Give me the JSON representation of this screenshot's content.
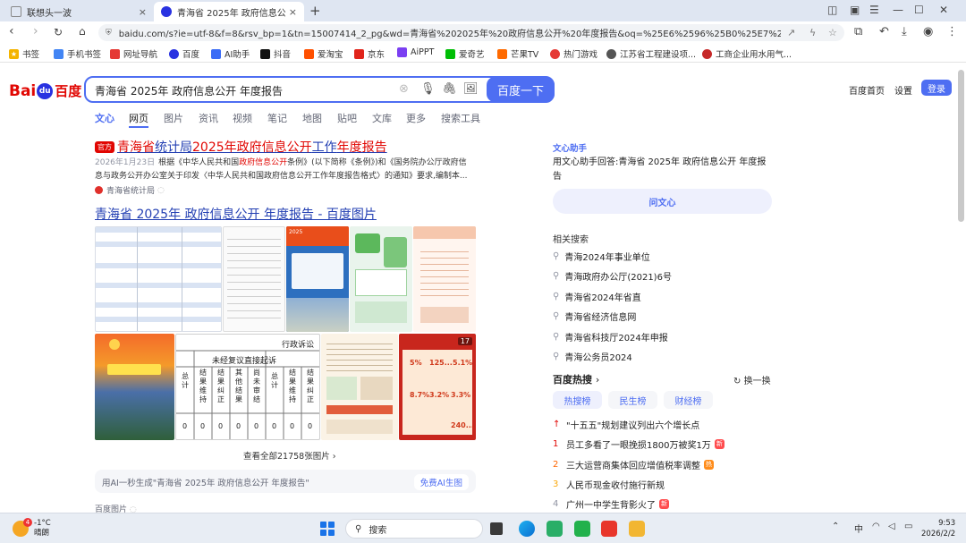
{
  "browser": {
    "tabs": [
      {
        "label": "联想头一波",
        "close": "×"
      },
      {
        "label": "青海省 2025年 政府信息公开 年度",
        "close": "×"
      }
    ],
    "new_tab": "+",
    "url": "baidu.com/s?ie=utf-8&f=8&rsv_bp=1&tn=15007414_2_pg&wd=青海省%202025年%20政府信息公开%20年度报告&oq=%25E6%2596%25B0%25E7%2596%2586%25E7%25BB%25B4%25E5%2590%25BE..."
  },
  "bookmarks": [
    {
      "label": "书签",
      "color": "#f4b400"
    },
    {
      "label": "手机书签",
      "color": "#4285f4"
    },
    {
      "label": "网址导航",
      "color": "#e53935"
    },
    {
      "label": "百度",
      "color": "#2932e1"
    },
    {
      "label": "AI助手",
      "color": "#3b6cf6"
    },
    {
      "label": "抖音",
      "color": "#111111"
    },
    {
      "label": "爱淘宝",
      "color": "#ff5000"
    },
    {
      "label": "京东",
      "color": "#e1251b"
    },
    {
      "label": "AiPPT",
      "color": "#7b3ff2"
    },
    {
      "label": "爱奇艺",
      "color": "#00be06"
    },
    {
      "label": "芒果TV",
      "color": "#ff6a00"
    },
    {
      "label": "热门游戏",
      "color": "#e53935"
    },
    {
      "label": "江苏省工程建设项...",
      "color": "#555555"
    },
    {
      "label": "工商企业用水用气...",
      "color": "#c62828"
    }
  ],
  "baidu": {
    "logo_left": "Bai",
    "logo_paw": "du",
    "logo_right": "百度",
    "query": "青海省 2025年 政府信息公开 年度报告",
    "search_button": "百度一下",
    "header_links": [
      "百度首页",
      "设置"
    ],
    "login": "登录",
    "tabs": [
      "文心",
      "网页",
      "图片",
      "资讯",
      "视频",
      "笔记",
      "地图",
      "贴吧",
      "文库",
      "更多",
      "搜索工具"
    ]
  },
  "result1": {
    "badge": "官方",
    "title_parts": [
      "青海省",
      "统计局",
      "2025年政府信息公开",
      "工作",
      "年度报告"
    ],
    "date": "2026年1月23日",
    "desc_a": "根据《中华人民共和国",
    "desc_hl": "政府信息公开",
    "desc_b": "条例》(以下简称《条例》)和《国务院办公厅政府信息与政务公开办公室关于印发〈中华人民共和国政府信息公开工作年度报告格式〉的通知》要求,编制本...",
    "source": "青海省统计局"
  },
  "result2": {
    "title": "青海省 2025年 政府信息公开 年度报告 - 百度图片"
  },
  "image_grid": {
    "see_all": "查看全部21758张图片",
    "table_header": "行政诉讼",
    "table_sub": "未经复议直接起诉",
    "table_cols": [
      "总计",
      "结果维持",
      "结果纠正",
      "其他结果",
      "尚未审结",
      "总计",
      "结果维持",
      "结果纠正"
    ],
    "table_zero": "0",
    "panel_banner": "2025",
    "photo_badge": "17",
    "stat_values": [
      "5%",
      "125...",
      "5.1%",
      "8.7%",
      "3.2%",
      "3.3%",
      "240..."
    ]
  },
  "ai_bar": {
    "text": "用AI一秒生成\"青海省 2025年 政府信息公开 年度报告\"",
    "button": "免费AI生图"
  },
  "image_source": "百度图片",
  "right": {
    "wenxin_head": "文心助手",
    "wenxin_answer": "用文心助手回答:青海省 2025年 政府信息公开 年度报告",
    "ask_button": "问文心",
    "related_head": "相关搜索",
    "related": [
      "青海2024年事业单位",
      "青海政府办公厅(2021)6号",
      "青海省2024年省直",
      "青海省经济信息网",
      "青海省科技厅2024年申报",
      "青海公务员2024"
    ],
    "hot_head": "百度热搜",
    "refresh": "换一换",
    "pills": [
      "热搜榜",
      "民生榜",
      "财经榜"
    ],
    "hot": [
      {
        "rank": "千",
        "text": "\"十五五\"规划建议列出六个增长点",
        "tag": "",
        "color": "#e10602"
      },
      {
        "rank": "1",
        "text": "员工多看了一眼挽损1800万被奖1万",
        "tag": "新",
        "color": "#e10602"
      },
      {
        "rank": "2",
        "text": "三大运营商集体回应增值税率调整",
        "tag": "热",
        "color": "#ff6600"
      },
      {
        "rank": "3",
        "text": "人民币现金收付施行新规",
        "tag": "",
        "color": "#faa90e"
      },
      {
        "rank": "4",
        "text": "广州一中学生背影火了",
        "tag": "新",
        "color": "#9195a3"
      }
    ]
  },
  "taskbar": {
    "weather_num": "4",
    "temp": "-1°C",
    "condition": "晴朗",
    "search": "搜索",
    "tray_ime": "中",
    "time": "9:53",
    "date": "2026/2/2"
  }
}
